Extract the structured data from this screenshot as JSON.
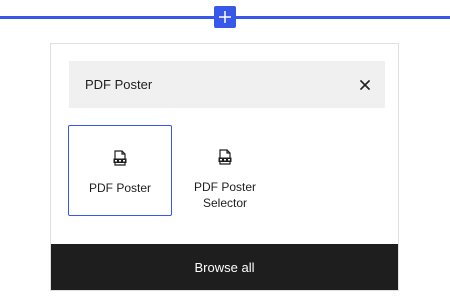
{
  "colors": {
    "accent": "#3858e9",
    "search_bg": "#f0f0f0",
    "footer_bg": "#1e1e1e",
    "text": "#1e1e1e"
  },
  "inserter": {
    "toggle_icon": "plus-icon"
  },
  "search": {
    "value": "PDF Poster",
    "clear_icon": "close-icon"
  },
  "blocks": [
    {
      "label": "PDF Poster",
      "icon": "pdf-file-icon",
      "selected": true
    },
    {
      "label": "PDF Poster Selector",
      "icon": "pdf-file-icon",
      "selected": false
    }
  ],
  "footer": {
    "browse_all_label": "Browse all"
  }
}
